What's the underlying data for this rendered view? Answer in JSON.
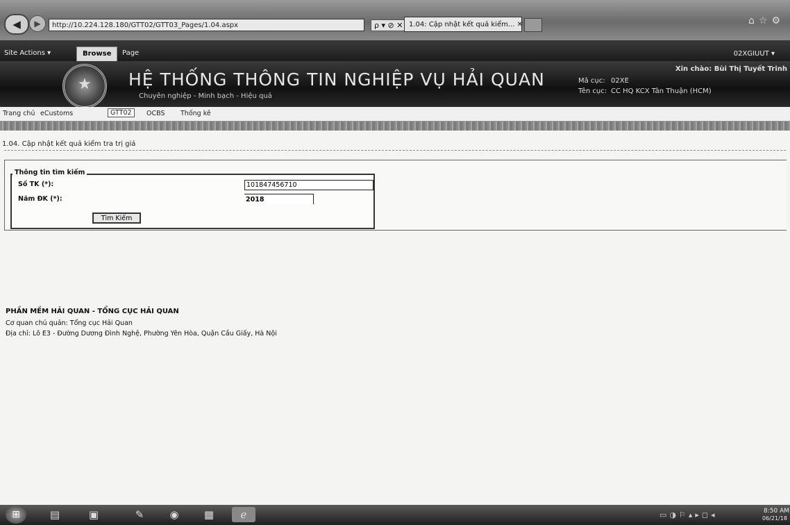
{
  "browser": {
    "url": "http://10.224.128.180/GTT02/GTT03_Pages/1.04.aspx",
    "search_controls": "ρ ▾ ⊘ ✕",
    "tab_title": "1.04: Cập nhật kết quả kiểm... ✕"
  },
  "ribbon": {
    "site_actions": "Site Actions ▾",
    "tab_browse": "Browse",
    "tab_page": "Page",
    "user": "02XGIUUT ▾"
  },
  "banner": {
    "title": "HỆ THỐNG THÔNG TIN NGHIỆP VỤ HẢI QUAN",
    "slogan": "Chuyên nghiệp - Minh bạch - Hiệu quả",
    "greeting": "Xin chào: Bùi Thị Tuyết Trinh",
    "unit_code_label": "Mã cục:",
    "unit_code": "02XE",
    "unit_name_label": "Tên cục:",
    "unit_name": "CC HQ KCX Tân Thuận (HCM)"
  },
  "menu": {
    "home": "Trang chủ",
    "ecustoms": "eCustoms",
    "gtt02": "GTT02",
    "ocbs": "OCBS",
    "stats": "Thống kê"
  },
  "page": {
    "title": "1.04. Cập nhật kết quả kiểm tra trị giá"
  },
  "search": {
    "legend": "Thông tin tìm kiếm",
    "so_tk_label": "Số TK (*):",
    "so_tk_value": "101847456710",
    "nam_dk_label": "Năm ĐK (*):",
    "nam_dk_value": "2018",
    "button": "Tìm Kiếm"
  },
  "footer": {
    "title": "PHẦN MỀM HẢI QUAN - TỔNG CỤC HẢI QUAN",
    "agency": "Cơ quan chủ quản: Tổng cục Hải Quan",
    "address": "Địa chỉ: Lô E3 - Đường Dương Đình Nghệ, Phường Yên Hòa, Quận Cầu Giấy, Hà Nội"
  },
  "taskbar": {
    "time": "8:50 AM",
    "date": "06/21/18"
  }
}
